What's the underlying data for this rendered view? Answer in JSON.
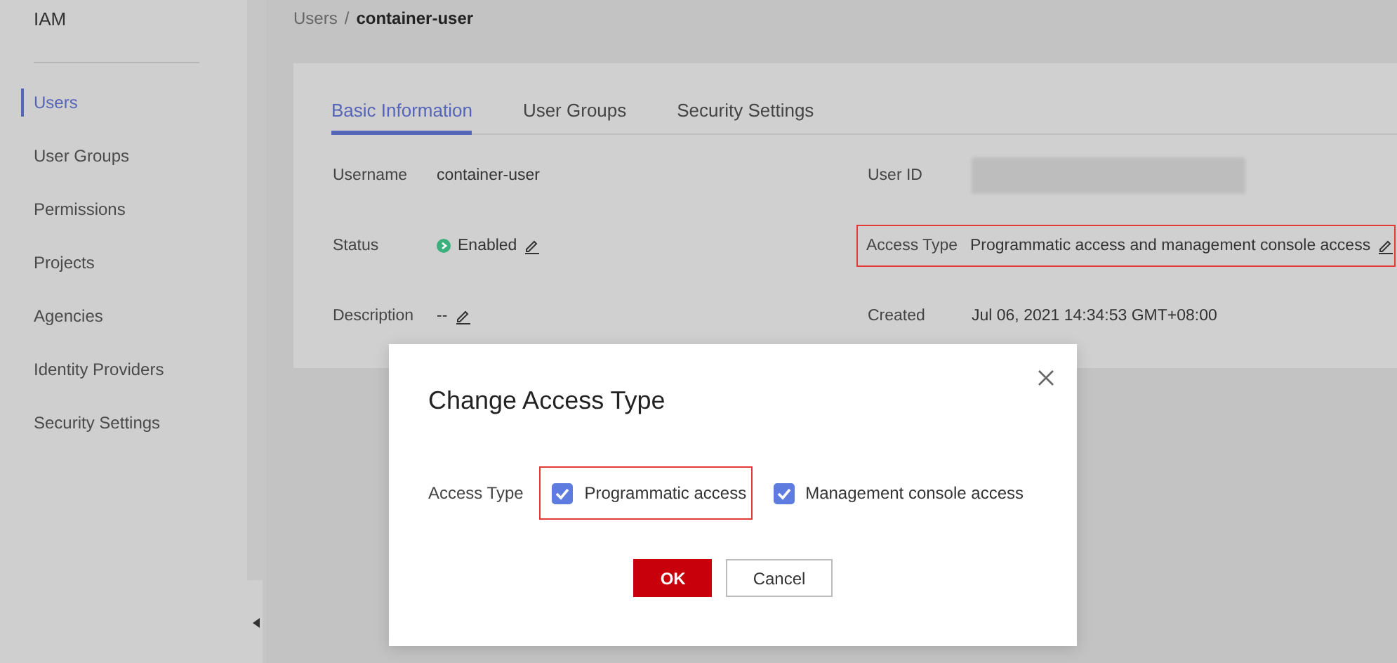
{
  "sidebar": {
    "title": "IAM",
    "items": [
      {
        "label": "Users",
        "selected": true
      },
      {
        "label": "User Groups",
        "selected": false
      },
      {
        "label": "Permissions",
        "selected": false
      },
      {
        "label": "Projects",
        "selected": false
      },
      {
        "label": "Agencies",
        "selected": false
      },
      {
        "label": "Identity Providers",
        "selected": false
      },
      {
        "label": "Security Settings",
        "selected": false
      }
    ]
  },
  "breadcrumb": {
    "parent": "Users",
    "separator": "/",
    "current": "container-user"
  },
  "tabs": [
    {
      "label": "Basic Information",
      "selected": true
    },
    {
      "label": "User Groups",
      "selected": false
    },
    {
      "label": "Security Settings",
      "selected": false
    }
  ],
  "fields": [
    {
      "label": "Username",
      "kind": "text",
      "value": "container-user",
      "editable": false,
      "highlighted": false
    },
    {
      "label": "User ID",
      "kind": "redacted",
      "editable": false,
      "highlighted": false
    },
    {
      "label": "Status",
      "kind": "status",
      "value": "Enabled",
      "editable": true,
      "highlighted": false
    },
    {
      "label": "Access Type",
      "kind": "text",
      "value": "Programmatic access and management console access",
      "editable": true,
      "highlighted": true
    },
    {
      "label": "Description",
      "kind": "text",
      "value": "--",
      "editable": true,
      "highlighted": false
    },
    {
      "label": "Created",
      "kind": "text",
      "value": "Jul 06, 2021 14:34:53 GMT+08:00",
      "editable": false,
      "highlighted": false
    }
  ],
  "dialog": {
    "title": "Change Access Type",
    "label": "Access Type",
    "options": [
      {
        "label": "Programmatic access",
        "checked": true,
        "highlighted": true
      },
      {
        "label": "Management console access",
        "checked": true,
        "highlighted": false
      }
    ],
    "buttons": [
      {
        "label": "OK",
        "kind": "primary"
      },
      {
        "label": "Cancel",
        "kind": "secondary"
      }
    ]
  }
}
